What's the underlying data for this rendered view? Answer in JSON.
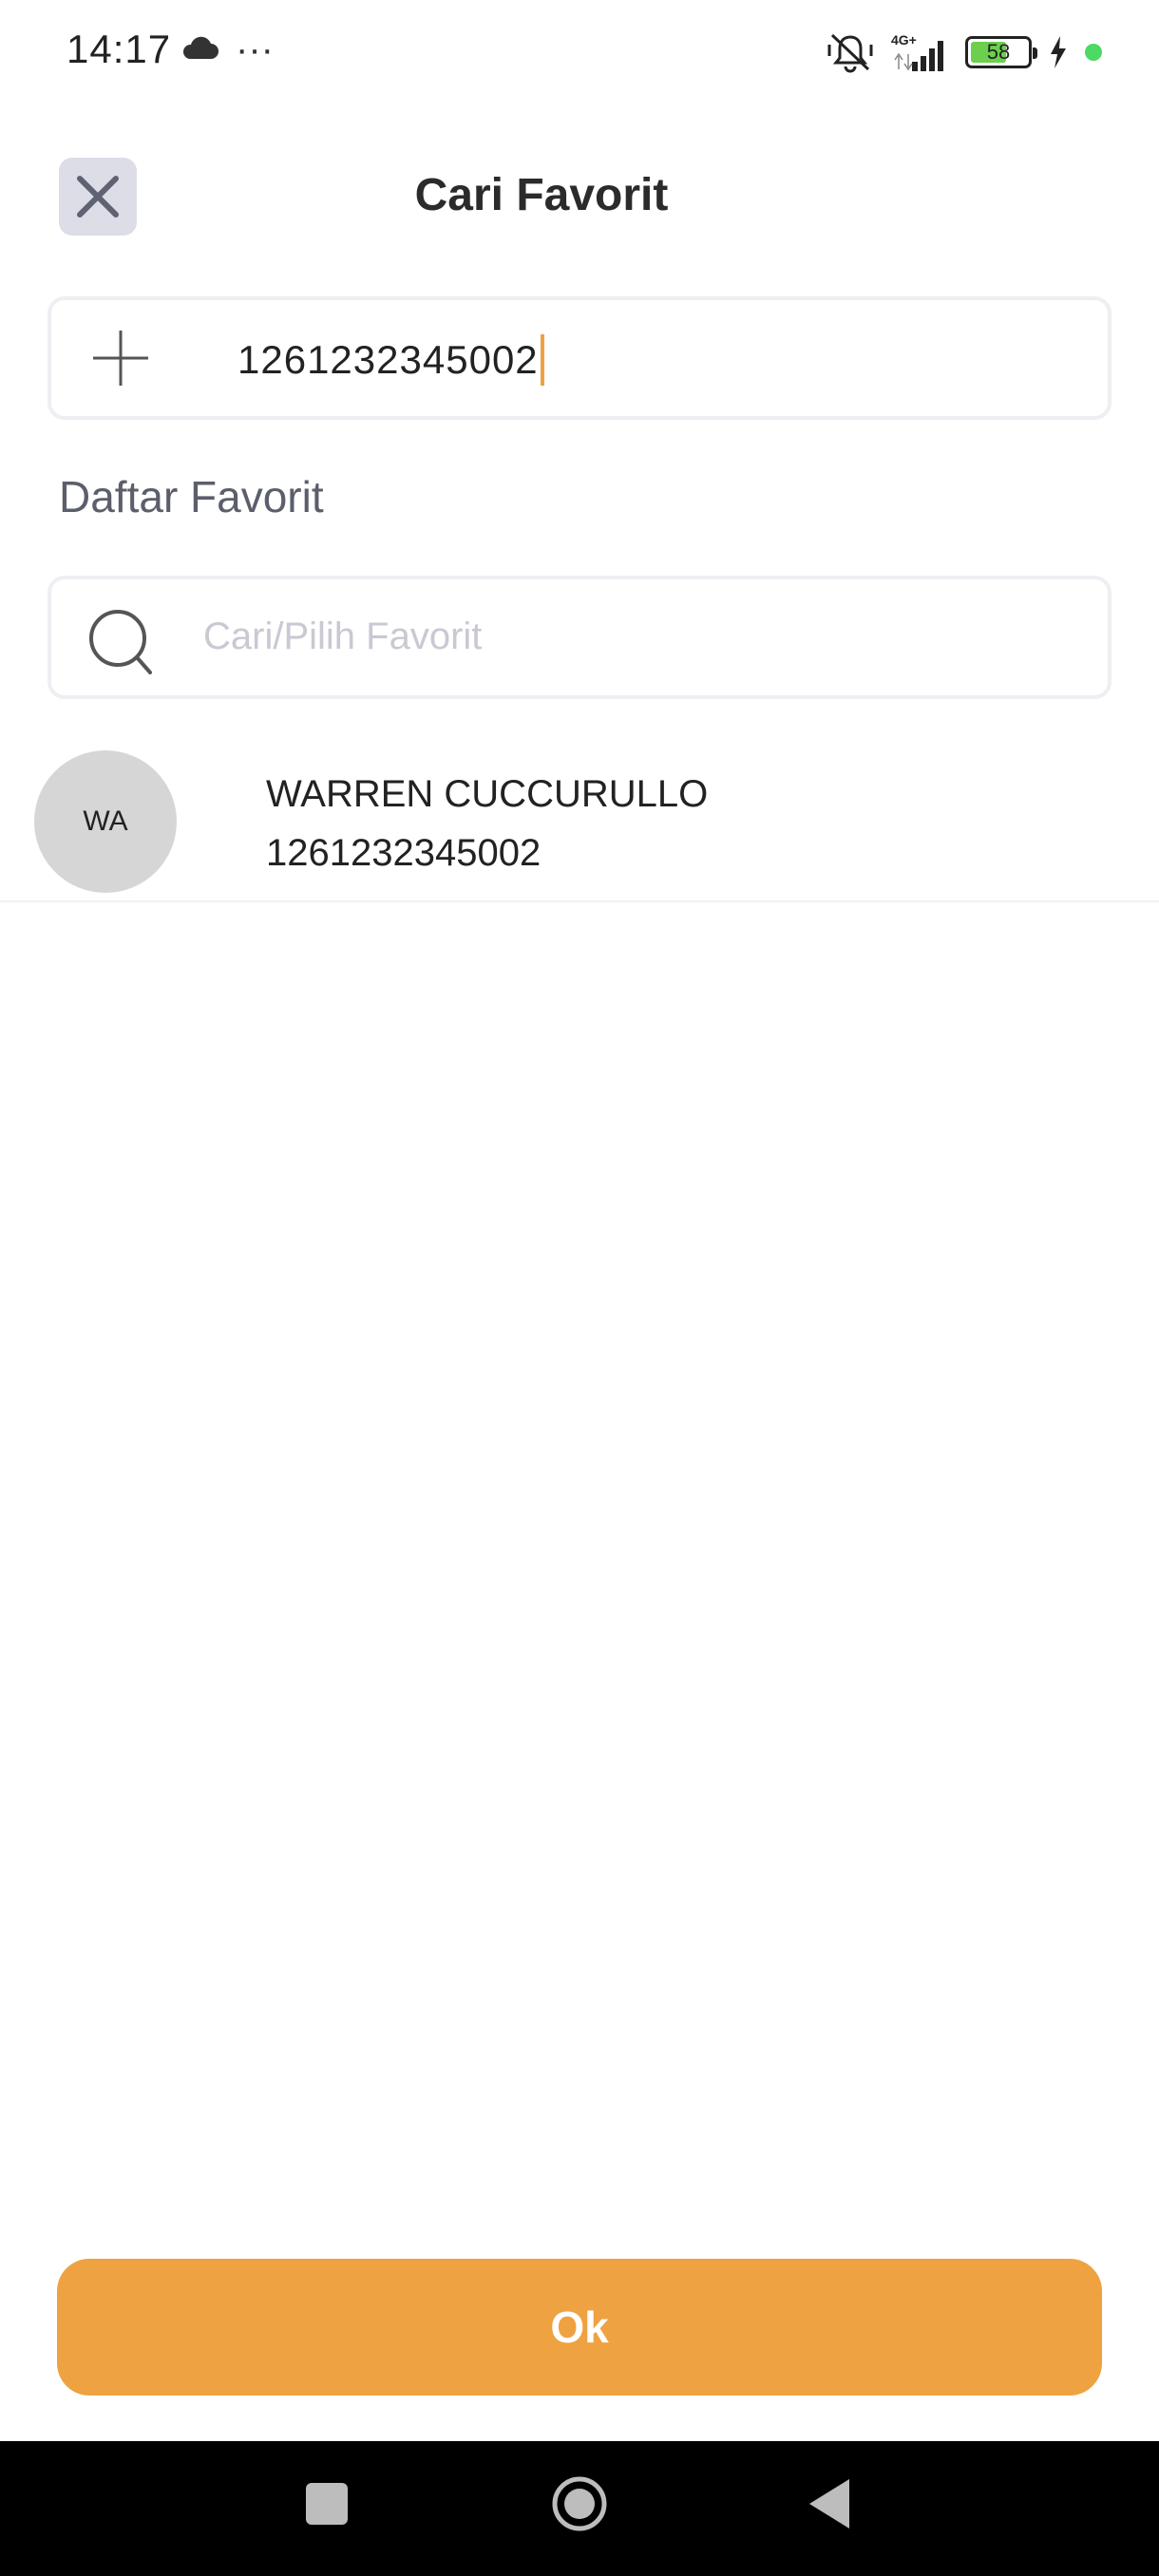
{
  "status_bar": {
    "time": "14:17",
    "more": "···",
    "battery_level": "58",
    "battery_fraction": 0.58,
    "network": "4G+"
  },
  "header": {
    "title": "Cari Favorit",
    "close_icon": "close-icon"
  },
  "input": {
    "value": "1261232345002",
    "icon": "plus-icon"
  },
  "favorites": {
    "section_title": "Daftar Favorit",
    "search_placeholder": "Cari/Pilih Favorit",
    "items": [
      {
        "initials": "WA",
        "name": "WARREN CUCCURULLO",
        "number": "1261232345002"
      }
    ]
  },
  "actions": {
    "ok_label": "Ok"
  },
  "colors": {
    "accent": "#eea241",
    "close_bg": "#dcdde6",
    "avatar_bg": "#d6d6d6"
  }
}
